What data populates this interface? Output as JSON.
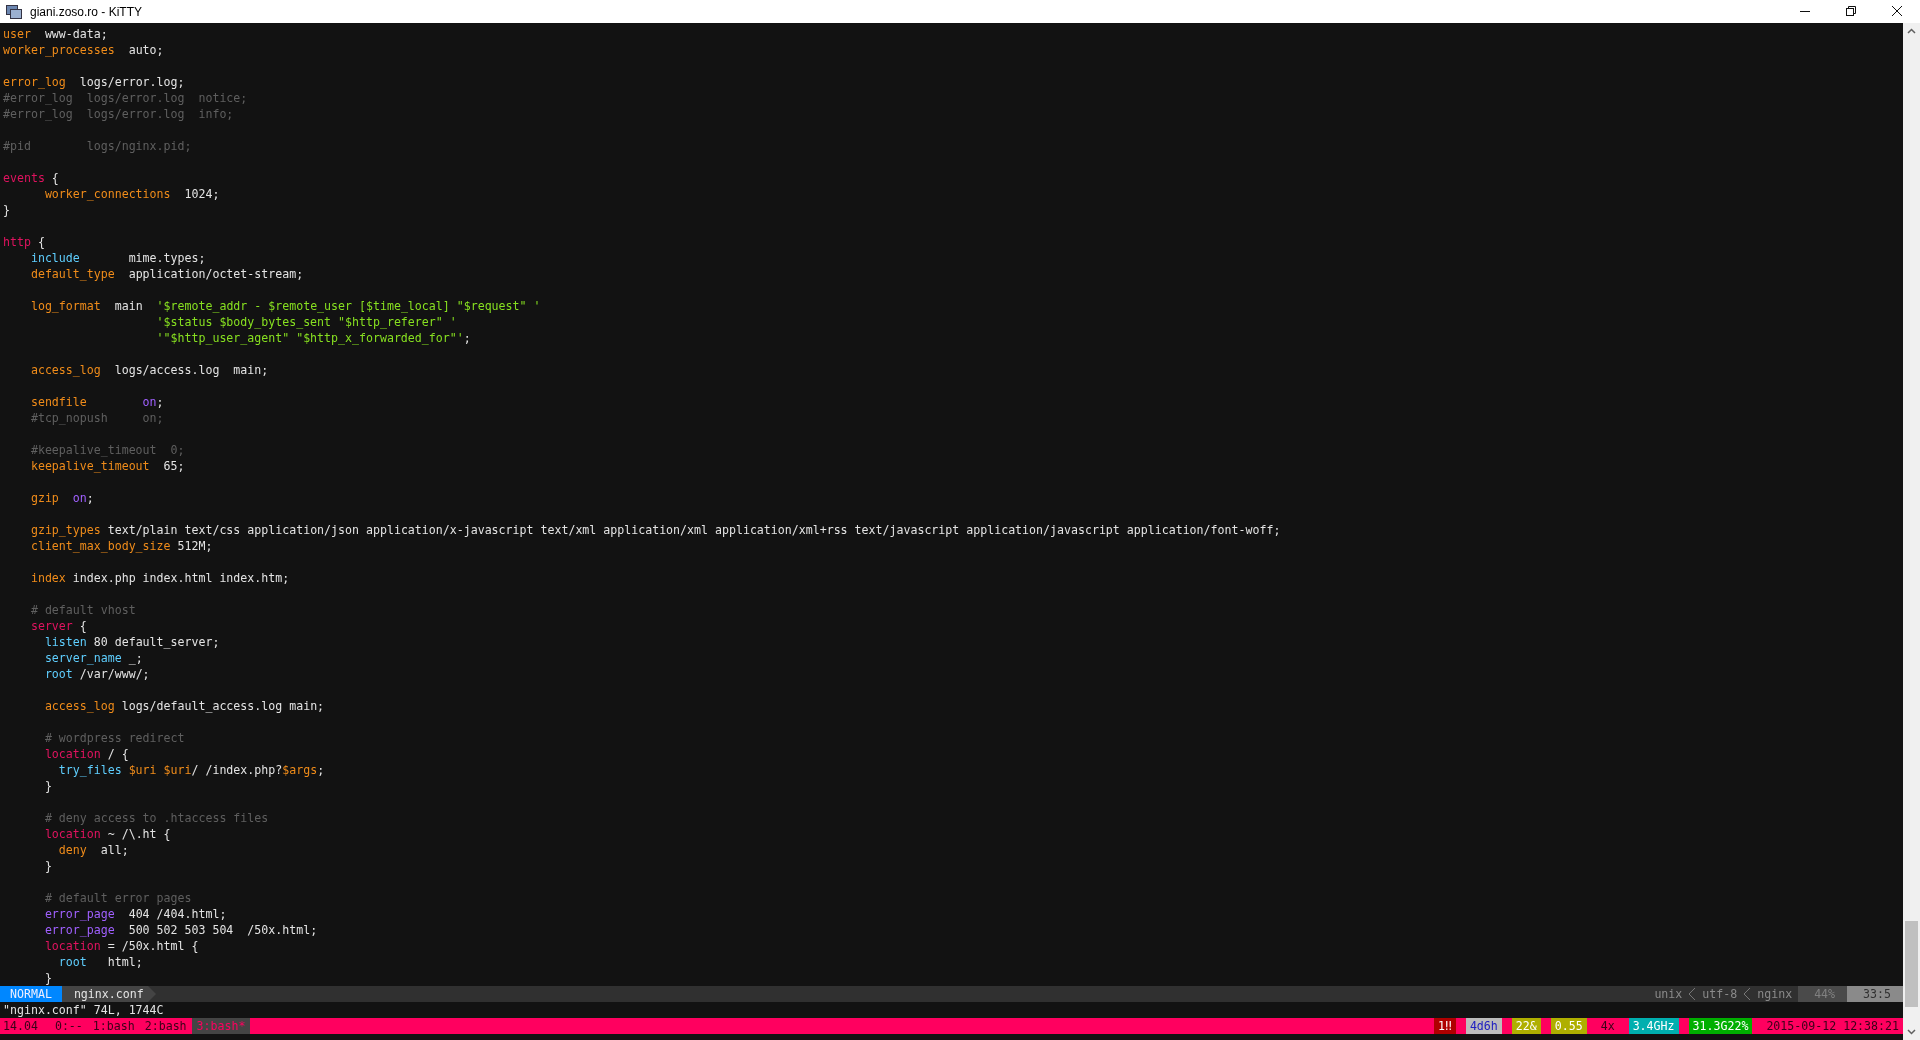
{
  "window": {
    "title": "giani.zoso.ro - KiTTY"
  },
  "editor": {
    "lines": [
      {
        "kind": "code",
        "tokens": [
          {
            "kind": "dir",
            "text": "user"
          },
          {
            "kind": "plain",
            "text": "  www-data;"
          }
        ]
      },
      {
        "kind": "code",
        "tokens": [
          {
            "kind": "dir",
            "text": "worker_processes"
          },
          {
            "kind": "plain",
            "text": "  auto;"
          }
        ]
      },
      {
        "kind": "blank"
      },
      {
        "kind": "code",
        "tokens": [
          {
            "kind": "dir",
            "text": "error_log"
          },
          {
            "kind": "plain",
            "text": "  logs/error.log;"
          }
        ]
      },
      {
        "kind": "code",
        "tokens": [
          {
            "kind": "comment",
            "text": "#error_log  logs/error.log  notice;"
          }
        ]
      },
      {
        "kind": "code",
        "tokens": [
          {
            "kind": "comment",
            "text": "#error_log  logs/error.log  info;"
          }
        ]
      },
      {
        "kind": "blank"
      },
      {
        "kind": "code",
        "tokens": [
          {
            "kind": "comment",
            "text": "#pid        logs/nginx.pid;"
          }
        ]
      },
      {
        "kind": "blank"
      },
      {
        "kind": "code",
        "tokens": [
          {
            "kind": "block",
            "text": "events"
          },
          {
            "kind": "plain",
            "text": " {"
          }
        ]
      },
      {
        "kind": "code",
        "tokens": [
          {
            "kind": "dir",
            "text": "      worker_connections"
          },
          {
            "kind": "plain",
            "text": "  1024;"
          }
        ]
      },
      {
        "kind": "code",
        "tokens": [
          {
            "kind": "plain",
            "text": "}"
          }
        ]
      },
      {
        "kind": "blank"
      },
      {
        "kind": "code",
        "tokens": [
          {
            "kind": "block",
            "text": "http"
          },
          {
            "kind": "plain",
            "text": " {"
          }
        ]
      },
      {
        "kind": "code",
        "tokens": [
          {
            "kind": "ident",
            "text": "    include"
          },
          {
            "kind": "plain",
            "text": "       mime.types;"
          }
        ]
      },
      {
        "kind": "code",
        "tokens": [
          {
            "kind": "dir",
            "text": "    default_type"
          },
          {
            "kind": "plain",
            "text": "  application/octet-stream;"
          }
        ]
      },
      {
        "kind": "blank"
      },
      {
        "kind": "code",
        "tokens": [
          {
            "kind": "dir",
            "text": "    log_format"
          },
          {
            "kind": "plain",
            "text": "  main  "
          },
          {
            "kind": "string",
            "text": "'$remote_addr - $remote_user [$time_local] \"$request\" '"
          }
        ]
      },
      {
        "kind": "code",
        "tokens": [
          {
            "kind": "string",
            "text": "                      '$status $body_bytes_sent \"$http_referer\" '"
          }
        ]
      },
      {
        "kind": "code",
        "tokens": [
          {
            "kind": "string",
            "text": "                      '\"$http_user_agent\" \"$http_x_forwarded_for\"'"
          },
          {
            "kind": "plain",
            "text": ";"
          }
        ]
      },
      {
        "kind": "blank"
      },
      {
        "kind": "code",
        "tokens": [
          {
            "kind": "dir",
            "text": "    access_log"
          },
          {
            "kind": "plain",
            "text": "  logs/access.log  main;"
          }
        ]
      },
      {
        "kind": "blank"
      },
      {
        "kind": "code",
        "tokens": [
          {
            "kind": "dir",
            "text": "    sendfile        "
          },
          {
            "kind": "const",
            "text": "on"
          },
          {
            "kind": "plain",
            "text": ";"
          }
        ]
      },
      {
        "kind": "code",
        "tokens": [
          {
            "kind": "comment",
            "text": "    #tcp_nopush     on;"
          }
        ]
      },
      {
        "kind": "blank"
      },
      {
        "kind": "code",
        "tokens": [
          {
            "kind": "comment",
            "text": "    #keepalive_timeout  0;"
          }
        ]
      },
      {
        "kind": "code",
        "tokens": [
          {
            "kind": "dir",
            "text": "    keepalive_timeout"
          },
          {
            "kind": "plain",
            "text": "  65;"
          }
        ]
      },
      {
        "kind": "blank"
      },
      {
        "kind": "code",
        "tokens": [
          {
            "kind": "dir",
            "text": "    gzip  "
          },
          {
            "kind": "const",
            "text": "on"
          },
          {
            "kind": "plain",
            "text": ";"
          }
        ]
      },
      {
        "kind": "blank"
      },
      {
        "kind": "code",
        "tokens": [
          {
            "kind": "dir",
            "text": "    gzip_types"
          },
          {
            "kind": "plain",
            "text": " text/plain text/css application/json application/x-javascript text/xml application/xml application/xml+rss text/javascript application/javascript application/font-woff;"
          }
        ]
      },
      {
        "kind": "code",
        "tokens": [
          {
            "kind": "dir",
            "text": "    client_max_body_size"
          },
          {
            "kind": "plain",
            "text": " 512M;"
          }
        ]
      },
      {
        "kind": "blank"
      },
      {
        "kind": "code",
        "tokens": [
          {
            "kind": "dir",
            "text": "    index"
          },
          {
            "kind": "plain",
            "text": " index.php index.html index.htm;"
          }
        ]
      },
      {
        "kind": "blank"
      },
      {
        "kind": "code",
        "tokens": [
          {
            "kind": "comment",
            "text": "    # default vhost"
          }
        ]
      },
      {
        "kind": "code",
        "tokens": [
          {
            "kind": "block",
            "text": "    server"
          },
          {
            "kind": "plain",
            "text": " {"
          }
        ]
      },
      {
        "kind": "code",
        "tokens": [
          {
            "kind": "ident",
            "text": "      listen"
          },
          {
            "kind": "plain",
            "text": " 80 default_server;"
          }
        ]
      },
      {
        "kind": "code",
        "tokens": [
          {
            "kind": "ident",
            "text": "      server_name"
          },
          {
            "kind": "plain",
            "text": " _;"
          }
        ]
      },
      {
        "kind": "code",
        "tokens": [
          {
            "kind": "ident",
            "text": "      root"
          },
          {
            "kind": "plain",
            "text": " /var/www/;"
          }
        ]
      },
      {
        "kind": "blank"
      },
      {
        "kind": "code",
        "tokens": [
          {
            "kind": "dir",
            "text": "      access_log"
          },
          {
            "kind": "plain",
            "text": " logs/default_access.log main;"
          }
        ]
      },
      {
        "kind": "blank"
      },
      {
        "kind": "code",
        "tokens": [
          {
            "kind": "comment",
            "text": "      # wordpress redirect"
          }
        ]
      },
      {
        "kind": "code",
        "tokens": [
          {
            "kind": "block",
            "text": "      location"
          },
          {
            "kind": "plain",
            "text": " / {"
          }
        ]
      },
      {
        "kind": "code",
        "tokens": [
          {
            "kind": "ident",
            "text": "        try_files "
          },
          {
            "kind": "dir",
            "text": "$uri"
          },
          {
            "kind": "dir",
            "text": " $uri"
          },
          {
            "kind": "plain",
            "text": "/ /index.php?"
          },
          {
            "kind": "dir",
            "text": "$args"
          },
          {
            "kind": "plain",
            "text": ";"
          }
        ]
      },
      {
        "kind": "code",
        "tokens": [
          {
            "kind": "plain",
            "text": "      }"
          }
        ]
      },
      {
        "kind": "blank"
      },
      {
        "kind": "code",
        "tokens": [
          {
            "kind": "comment",
            "text": "      # deny access to .htaccess files"
          }
        ]
      },
      {
        "kind": "code",
        "tokens": [
          {
            "kind": "block",
            "text": "      location"
          },
          {
            "kind": "plain",
            "text": " ~ /\\.ht {"
          }
        ]
      },
      {
        "kind": "code",
        "tokens": [
          {
            "kind": "dir",
            "text": "        deny"
          },
          {
            "kind": "plain",
            "text": "  all;"
          }
        ]
      },
      {
        "kind": "code",
        "tokens": [
          {
            "kind": "plain",
            "text": "      }"
          }
        ]
      },
      {
        "kind": "blank"
      },
      {
        "kind": "code",
        "tokens": [
          {
            "kind": "comment",
            "text": "      # default error pages"
          }
        ]
      },
      {
        "kind": "code",
        "tokens": [
          {
            "kind": "const",
            "text": "      error_page"
          },
          {
            "kind": "plain",
            "text": "  404 /404.html;"
          }
        ]
      },
      {
        "kind": "code",
        "tokens": [
          {
            "kind": "const",
            "text": "      error_page"
          },
          {
            "kind": "plain",
            "text": "  500 502 503 504  /50x.html;"
          }
        ]
      },
      {
        "kind": "code",
        "tokens": [
          {
            "kind": "block",
            "text": "      location"
          },
          {
            "kind": "plain",
            "text": " = /50x.html {"
          }
        ]
      },
      {
        "kind": "code",
        "tokens": [
          {
            "kind": "ident",
            "text": "        root"
          },
          {
            "kind": "plain",
            "text": "   html;"
          }
        ]
      },
      {
        "kind": "code",
        "tokens": [
          {
            "kind": "plain",
            "text": "      }"
          }
        ]
      }
    ]
  },
  "status_line": {
    "mode": "NORMAL",
    "file": "nginx.conf",
    "format": "unix",
    "encoding": "utf-8",
    "filetype": "nginx",
    "percent": "44%",
    "position": "33:5"
  },
  "command_line": "\"nginx.conf\" 74L, 1744C",
  "tmux": {
    "session": "14.04",
    "windows": [
      {
        "label": "0:--",
        "selected": false
      },
      {
        "label": "1:bash",
        "selected": false
      },
      {
        "label": "2:bash",
        "selected": false
      },
      {
        "label": "3:bash*",
        "selected": true
      }
    ],
    "segments": [
      {
        "text": "1‼",
        "color": "#af0000"
      },
      {
        "text": "4d6h",
        "color": "#bcbcbc"
      },
      {
        "text": "22&",
        "color": "#afaf00"
      },
      {
        "text": "0.55",
        "color": "#afaf00"
      },
      {
        "text": "4x",
        "color": "#ff005f"
      },
      {
        "text": "3.4GHz",
        "color": "#00afaf"
      },
      {
        "text": "31.3G22%",
        "color": "#00af00"
      },
      {
        "text": "2015-09-12 12:38:21",
        "color": "#ff005f"
      }
    ]
  }
}
